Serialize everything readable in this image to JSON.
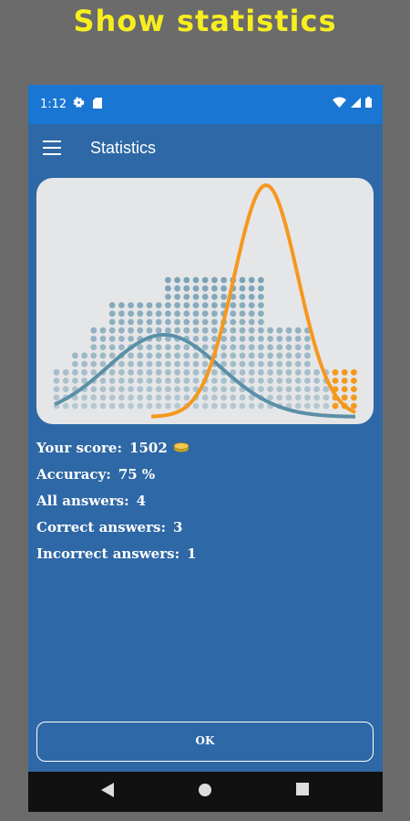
{
  "promo": {
    "title": "Show statistics"
  },
  "status_bar": {
    "time": "1:12",
    "left_icons": [
      "gear-icon",
      "sd-card-icon"
    ],
    "right_icons": [
      "wifi-icon",
      "cell-signal-icon",
      "battery-icon"
    ]
  },
  "app_bar": {
    "title": "Statistics",
    "menu_icon": "hamburger-menu-icon"
  },
  "chart_data": {
    "type": "histogram-with-distribution-curves",
    "title": "",
    "xlabel": "",
    "ylabel": "",
    "series": [
      {
        "kind": "dot-histogram",
        "color": "#5b8fa8",
        "column_heights": [
          5,
          5,
          5,
          5,
          7,
          7,
          7,
          7,
          10,
          10,
          10,
          10,
          13,
          13,
          13,
          13,
          13,
          13,
          13,
          13,
          13,
          13,
          13,
          13,
          16,
          16,
          16,
          16,
          16,
          16,
          16,
          16,
          16,
          16,
          16,
          16,
          16,
          16,
          16,
          16,
          16,
          16,
          16,
          16,
          16,
          16,
          10,
          10,
          10,
          10,
          10,
          10,
          10,
          10,
          10,
          10,
          5,
          5,
          5,
          5,
          5,
          5,
          5,
          5,
          5,
          5
        ]
      },
      {
        "kind": "dot-histogram-highlight",
        "color": "#f5981e",
        "column_heights": [
          0,
          0,
          0,
          0,
          0,
          0,
          0,
          0,
          0,
          0,
          0,
          0,
          0,
          0,
          0,
          0,
          0,
          0,
          0,
          0,
          0,
          0,
          0,
          0,
          0,
          0,
          0,
          0,
          0,
          0,
          0,
          0,
          0,
          0,
          0,
          0,
          0,
          0,
          0,
          0,
          0,
          0,
          0,
          0,
          0,
          0,
          0,
          0,
          0,
          0,
          0,
          0,
          0,
          0,
          0,
          0,
          0,
          0,
          0,
          0,
          5,
          5,
          5,
          5,
          5,
          5
        ]
      },
      {
        "kind": "curve",
        "color": "#5b8fa8",
        "shape": "wide-normal"
      },
      {
        "kind": "curve",
        "color": "#f5981e",
        "shape": "narrow-normal"
      }
    ]
  },
  "stats": {
    "score_label": "Your score:",
    "score_value": "1502",
    "accuracy_label": "Accuracy:",
    "accuracy_value": "75 %",
    "all_label": "All answers:",
    "all_value": "4",
    "correct_label": "Correct answers:",
    "correct_value": "3",
    "incorrect_label": "Incorrect answers:",
    "incorrect_value": "1",
    "score_icon": "coins-icon"
  },
  "ok_button": {
    "label": "OK"
  },
  "nav_bar": {
    "icons": [
      "back-triangle-icon",
      "home-circle-icon",
      "recents-square-icon"
    ]
  },
  "colors": {
    "app_blue": "#2e68a6",
    "status_blue": "#1976d2",
    "accent_orange": "#f5981e",
    "dot_blue": "#5b8fa8",
    "promo_yellow": "#f7ee1e"
  }
}
